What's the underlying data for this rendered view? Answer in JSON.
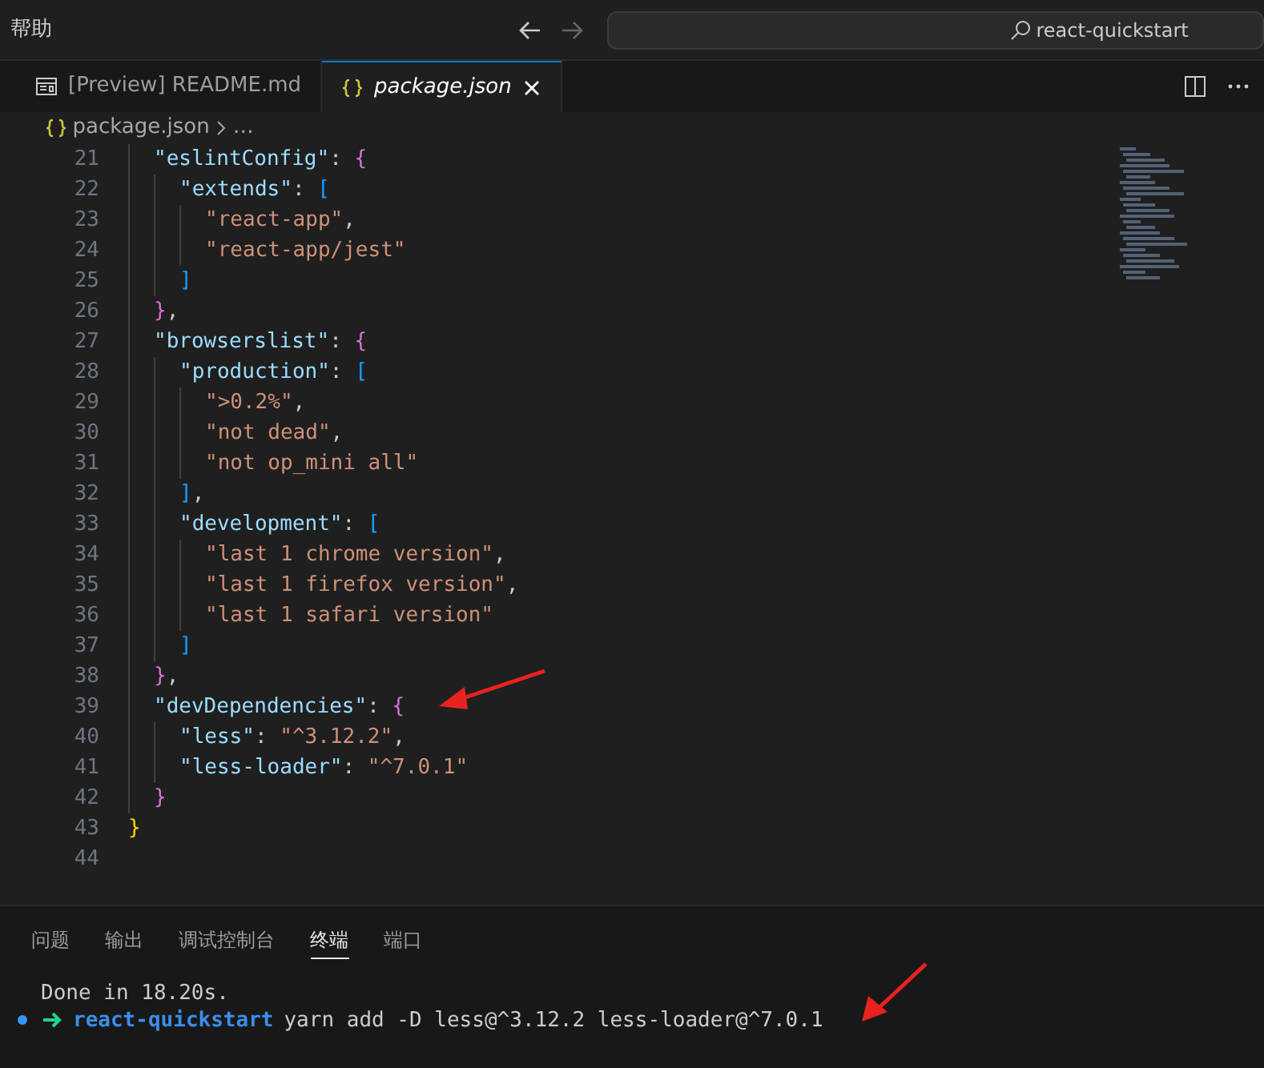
{
  "window": {
    "menu": "帮助",
    "search": "react-quickstart"
  },
  "tabs": [
    {
      "label": "[Preview] README.md",
      "kind": "preview",
      "selected": false
    },
    {
      "label": "package.json",
      "kind": "json",
      "selected": true
    }
  ],
  "breadcrumb": {
    "file": "package.json",
    "rest": "…"
  },
  "editor": {
    "lines": [
      {
        "number": "21",
        "tokens": [
          {
            "kind": "key",
            "text": "\"eslintConfig\""
          },
          {
            "kind": "punct",
            "text": ":"
          },
          {
            "kind": "brace2",
            "text": "{"
          }
        ],
        "children": [
          {
            "number": "22",
            "tokens": [
              {
                "kind": "key",
                "text": "\"extends\""
              },
              {
                "kind": "punct",
                "text": ":"
              },
              {
                "kind": "brace3",
                "text": "["
              }
            ],
            "children": [
              {
                "number": "23",
                "tokens": [
                  {
                    "kind": "str",
                    "text": "\"react-app\""
                  },
                  {
                    "kind": "punct",
                    "text": ","
                  }
                ]
              },
              {
                "number": "24",
                "tokens": [
                  {
                    "kind": "str",
                    "text": "\"react-app/jest\""
                  }
                ]
              }
            ]
          },
          {
            "number": "25",
            "tokens": [
              {
                "kind": "brace3",
                "text": "]"
              }
            ]
          }
        ]
      },
      {
        "number": "26",
        "tokens": [
          {
            "kind": "brace2",
            "text": "}"
          },
          {
            "kind": "punct",
            "text": ","
          }
        ]
      },
      {
        "number": "27",
        "tokens": [
          {
            "kind": "key",
            "text": "\"browserslist\""
          },
          {
            "kind": "punct",
            "text": ":"
          },
          {
            "kind": "brace2",
            "text": "{"
          }
        ],
        "children": [
          {
            "number": "28",
            "tokens": [
              {
                "kind": "key",
                "text": "\"production\""
              },
              {
                "kind": "punct",
                "text": ":"
              },
              {
                "kind": "brace3",
                "text": "["
              }
            ],
            "children": [
              {
                "number": "29",
                "tokens": [
                  {
                    "kind": "str",
                    "text": "\">0.2%\""
                  },
                  {
                    "kind": "punct",
                    "text": ","
                  }
                ]
              },
              {
                "number": "30",
                "tokens": [
                  {
                    "kind": "str",
                    "text": "\"not dead\""
                  },
                  {
                    "kind": "punct",
                    "text": ","
                  }
                ]
              },
              {
                "number": "31",
                "tokens": [
                  {
                    "kind": "str",
                    "text": "\"not op_mini all\""
                  }
                ]
              }
            ]
          },
          {
            "number": "32",
            "tokens": [
              {
                "kind": "brace3",
                "text": "]"
              },
              {
                "kind": "punct",
                "text": ","
              }
            ]
          },
          {
            "number": "33",
            "tokens": [
              {
                "kind": "key",
                "text": "\"development\""
              },
              {
                "kind": "punct",
                "text": ":"
              },
              {
                "kind": "brace3",
                "text": "["
              }
            ],
            "children": [
              {
                "number": "34",
                "tokens": [
                  {
                    "kind": "str",
                    "text": "\"last 1 chrome version\""
                  },
                  {
                    "kind": "punct",
                    "text": ","
                  }
                ]
              },
              {
                "number": "35",
                "tokens": [
                  {
                    "kind": "str",
                    "text": "\"last 1 firefox version\""
                  },
                  {
                    "kind": "punct",
                    "text": ","
                  }
                ]
              },
              {
                "number": "36",
                "tokens": [
                  {
                    "kind": "str",
                    "text": "\"last 1 safari version\""
                  }
                ]
              }
            ]
          },
          {
            "number": "37",
            "tokens": [
              {
                "kind": "brace3",
                "text": "]"
              }
            ]
          }
        ]
      },
      {
        "number": "38",
        "tokens": [
          {
            "kind": "brace2",
            "text": "}"
          },
          {
            "kind": "punct",
            "text": ","
          }
        ]
      },
      {
        "number": "39",
        "tokens": [
          {
            "kind": "key",
            "text": "\"devDependencies\""
          },
          {
            "kind": "punct",
            "text": ":"
          },
          {
            "kind": "brace2",
            "text": "{"
          }
        ],
        "children": [
          {
            "number": "40",
            "tokens": [
              {
                "kind": "key",
                "text": "\"less\""
              },
              {
                "kind": "punct",
                "text": ":"
              },
              {
                "kind": "str",
                "text": "\"^3.12.2\""
              },
              {
                "kind": "punct",
                "text": ","
              }
            ]
          },
          {
            "number": "41",
            "tokens": [
              {
                "kind": "key",
                "text": "\"less-loader\""
              },
              {
                "kind": "punct",
                "text": ":"
              },
              {
                "kind": "str",
                "text": "\"^7.0.1\""
              }
            ]
          }
        ]
      },
      {
        "number": "42",
        "tokens": [
          {
            "kind": "brace2",
            "text": "}"
          }
        ]
      }
    ],
    "tail_lines": [
      {
        "number": "43",
        "tokens": [
          {
            "kind": "brace1",
            "text": "}"
          }
        ]
      },
      {
        "number": "44"
      }
    ]
  },
  "panel": {
    "tabs": [
      {
        "label": "问题",
        "selected": false
      },
      {
        "label": "输出",
        "selected": false
      },
      {
        "label": "调试控制台",
        "selected": false
      },
      {
        "label": "终端",
        "selected": true
      },
      {
        "label": "端口",
        "selected": false
      }
    ],
    "terminal": [
      {
        "kind": "output",
        "text": "Done in 18.20s."
      },
      {
        "kind": "prompt",
        "cwd": "react-quickstart",
        "command": "yarn add -D less@^3.12.2 less-loader@^7.0.1"
      }
    ]
  }
}
